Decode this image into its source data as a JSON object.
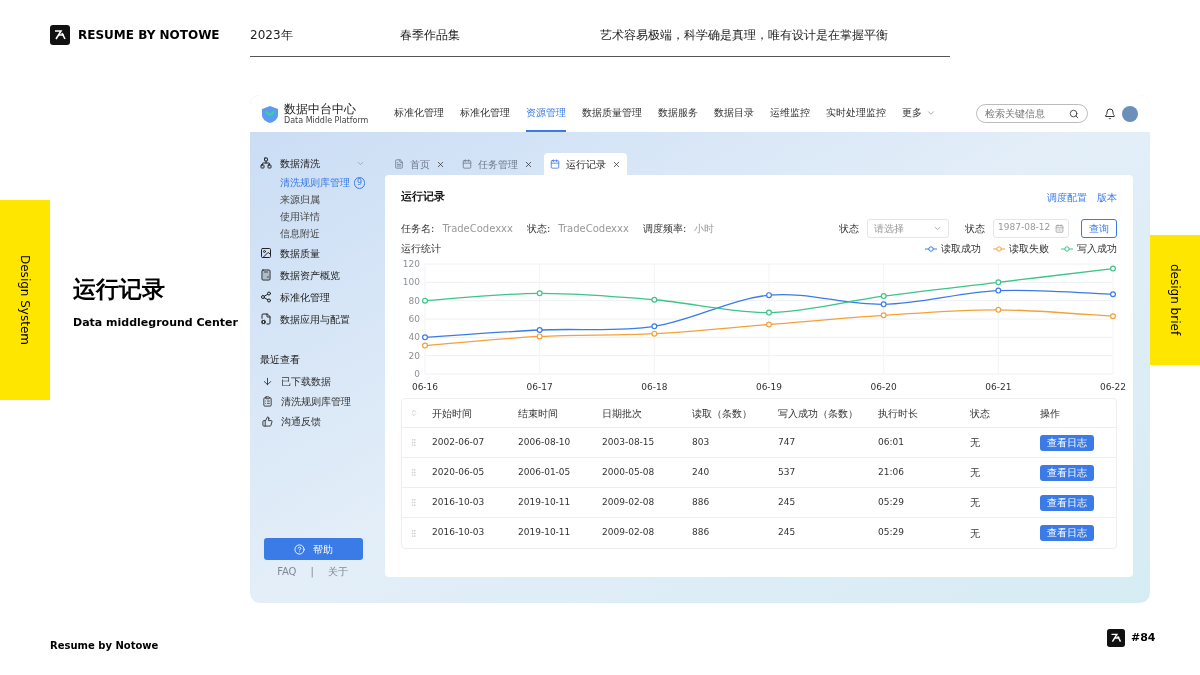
{
  "header": {
    "brand": "RESUME BY NOTOWE",
    "year": "2023年",
    "collection": "春季作品集",
    "motto": "艺术容易极端，科学确是真理，唯有设计是在掌握平衡"
  },
  "side_tabs": {
    "left": "Design System",
    "right": "design brief"
  },
  "slide_title": {
    "title": "运行记录",
    "subtitle": "Data middleground Center"
  },
  "app": {
    "logo": {
      "name": "数据中台中心",
      "sub": "Data Middle Platform"
    },
    "nav": [
      {
        "label": "标准化管理",
        "selected": false
      },
      {
        "label": "标准化管理",
        "selected": false
      },
      {
        "label": "资源管理",
        "selected": true
      },
      {
        "label": "数据质量管理",
        "selected": false
      },
      {
        "label": "数据服务",
        "selected": false
      },
      {
        "label": "数据目录",
        "selected": false
      },
      {
        "label": "运维监控",
        "selected": false
      },
      {
        "label": "实时处理监控",
        "selected": false
      },
      {
        "label": "更多",
        "selected": false,
        "kind": "dropdown"
      }
    ],
    "search": {
      "placeholder": "检索关键信息"
    },
    "sidebar": {
      "items": [
        {
          "label": "数据清洗",
          "expanded": true,
          "children": [
            {
              "label": "清洗规则库管理",
              "selected": true,
              "badge": "9"
            },
            {
              "label": "来源归属",
              "selected": false
            },
            {
              "label": "使用详情",
              "selected": false
            },
            {
              "label": "信息附近",
              "selected": false
            }
          ]
        },
        {
          "label": "数据质量"
        },
        {
          "label": "数据资产概览"
        },
        {
          "label": "标准化管理"
        },
        {
          "label": "数据应用与配置"
        }
      ],
      "recent_title": "最近查看",
      "recent": [
        {
          "label": "已下载数据"
        },
        {
          "label": "清洗规则库管理"
        },
        {
          "label": "沟通反馈"
        }
      ],
      "help": "帮助",
      "links": [
        "FAQ",
        "|",
        "关于"
      ]
    },
    "tabs": [
      {
        "label": "首页",
        "selected": false,
        "disabled": true
      },
      {
        "label": "任务管理",
        "selected": false,
        "disabled": true
      },
      {
        "label": "运行记录",
        "selected": true,
        "disabled": false
      }
    ],
    "card": {
      "title": "运行记录",
      "actions": [
        "调度配置",
        "版本"
      ],
      "filters": [
        {
          "label": "任务名:",
          "value": "TradeCodexxx"
        },
        {
          "label": "状态:",
          "value": "TradeCodexxx"
        },
        {
          "label": "调度频率:",
          "value": "小时"
        }
      ],
      "status_select": {
        "label": "状态",
        "placeholder": "请选择"
      },
      "date_field": {
        "label": "状态",
        "placeholder": "1987-08-12"
      },
      "query": "查询",
      "chart_label": "运行统计",
      "chart_data": {
        "type": "line",
        "grid": true,
        "categories": [
          "06-16",
          "06-17",
          "06-18",
          "06-19",
          "06-20",
          "06-21",
          "06-22"
        ],
        "ylim": [
          0,
          120
        ],
        "yticks": [
          0,
          20,
          40,
          60,
          80,
          100,
          120
        ],
        "series": [
          {
            "name": "读取成功",
            "color": "#3a7be8",
            "marker": "circle",
            "values": [
              40,
              48,
              52,
              86,
              76,
              91,
              87
            ]
          },
          {
            "name": "读取失败",
            "color": "#f5a03a",
            "marker": "circle",
            "values": [
              31,
              41,
              44,
              54,
              64,
              70,
              63
            ]
          },
          {
            "name": "写入成功",
            "color": "#3cc48a",
            "marker": "circle",
            "values": [
              80,
              88,
              81,
              67,
              85,
              100,
              115
            ]
          }
        ]
      },
      "table": {
        "columns": [
          "开始时间",
          "结束时间",
          "日期批次",
          "读取（条数）",
          "写入成功（条数）",
          "执行时长",
          "状态",
          "操作"
        ],
        "rows": [
          {
            "cells": [
              "2002-06-07",
              "2006-08-10",
              "2003-08-15",
              "803",
              "747",
              "06:01",
              "无"
            ],
            "action": "查看日志"
          },
          {
            "cells": [
              "2020-06-05",
              "2006-01-05",
              "2000-05-08",
              "240",
              "537",
              "21:06",
              "无"
            ],
            "action": "查看日志"
          },
          {
            "cells": [
              "2016-10-03",
              "2019-10-11",
              "2009-02-08",
              "886",
              "245",
              "05:29",
              "无"
            ],
            "action": "查看日志"
          },
          {
            "cells": [
              "2016-10-03",
              "2019-10-11",
              "2009-02-08",
              "886",
              "245",
              "05:29",
              "无"
            ],
            "action": "查看日志"
          }
        ]
      }
    }
  },
  "footer": {
    "brand": "Resume by Notowe",
    "page": "#84"
  }
}
